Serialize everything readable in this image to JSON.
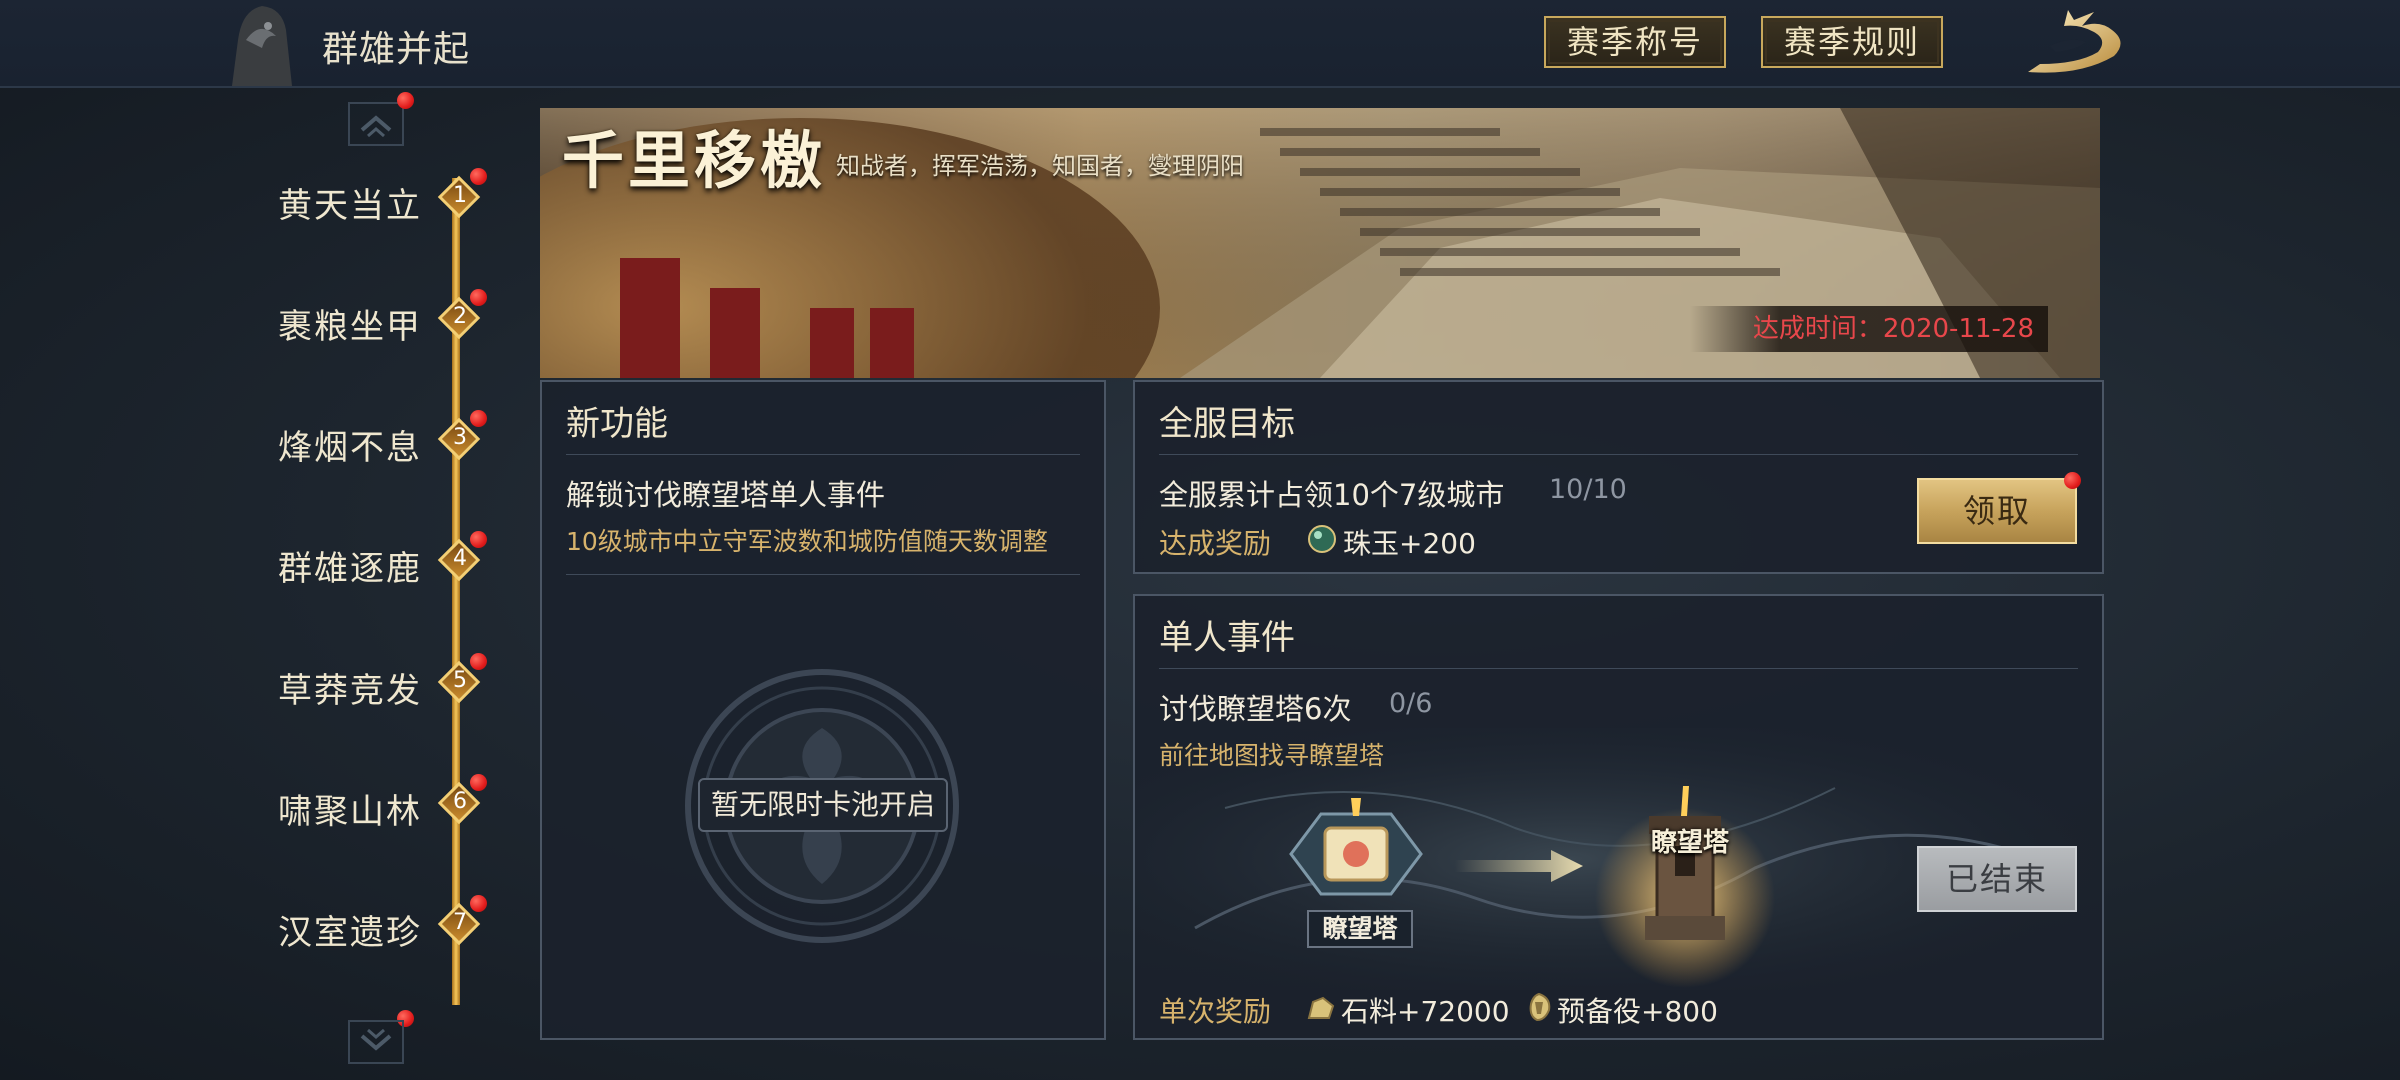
{
  "header": {
    "title": "群雄并起",
    "season_title_button": "赛季称号",
    "season_rules_button": "赛季规则"
  },
  "timeline": {
    "stages": [
      {
        "label": "黄天当立",
        "num": "1"
      },
      {
        "label": "裹粮坐甲",
        "num": "2"
      },
      {
        "label": "烽烟不息",
        "num": "3"
      },
      {
        "label": "群雄逐鹿",
        "num": "4"
      },
      {
        "label": "草莽竞发",
        "num": "5"
      },
      {
        "label": "啸聚山林",
        "num": "6"
      },
      {
        "label": "汉室遗珍",
        "num": "7"
      }
    ]
  },
  "banner": {
    "title": "千里移檄",
    "subtitle": "知战者，挥军浩荡，知国者，燮理阴阳",
    "achieved_time": "达成时间：2020-11-28"
  },
  "new_feature": {
    "title": "新功能",
    "line1": "解锁讨伐瞭望塔单人事件",
    "line2": "10级城市中立守军波数和城防值随天数调整",
    "empty_text": "暂无限时卡池开启"
  },
  "server_goal": {
    "title": "全服目标",
    "goal_text": "全服累计占领10个7级城市",
    "progress": "10/10",
    "reward_label": "达成奖励",
    "reward_value": "珠玉+200",
    "claim_button": "领取"
  },
  "solo_event": {
    "title": "单人事件",
    "task_text": "讨伐瞭望塔6次",
    "progress": "0/6",
    "hint": "前往地图找寻瞭望塔",
    "tower_label": "瞭望塔",
    "ended_button": "已结束",
    "reward_label": "单次奖励",
    "stone_reward": "石料+72000",
    "reserve_reward": "预备役+800"
  },
  "colors": {
    "gold_accent": "#d7b36c",
    "alert_red": "#e8474b",
    "panel_bg": "#1b222c"
  }
}
